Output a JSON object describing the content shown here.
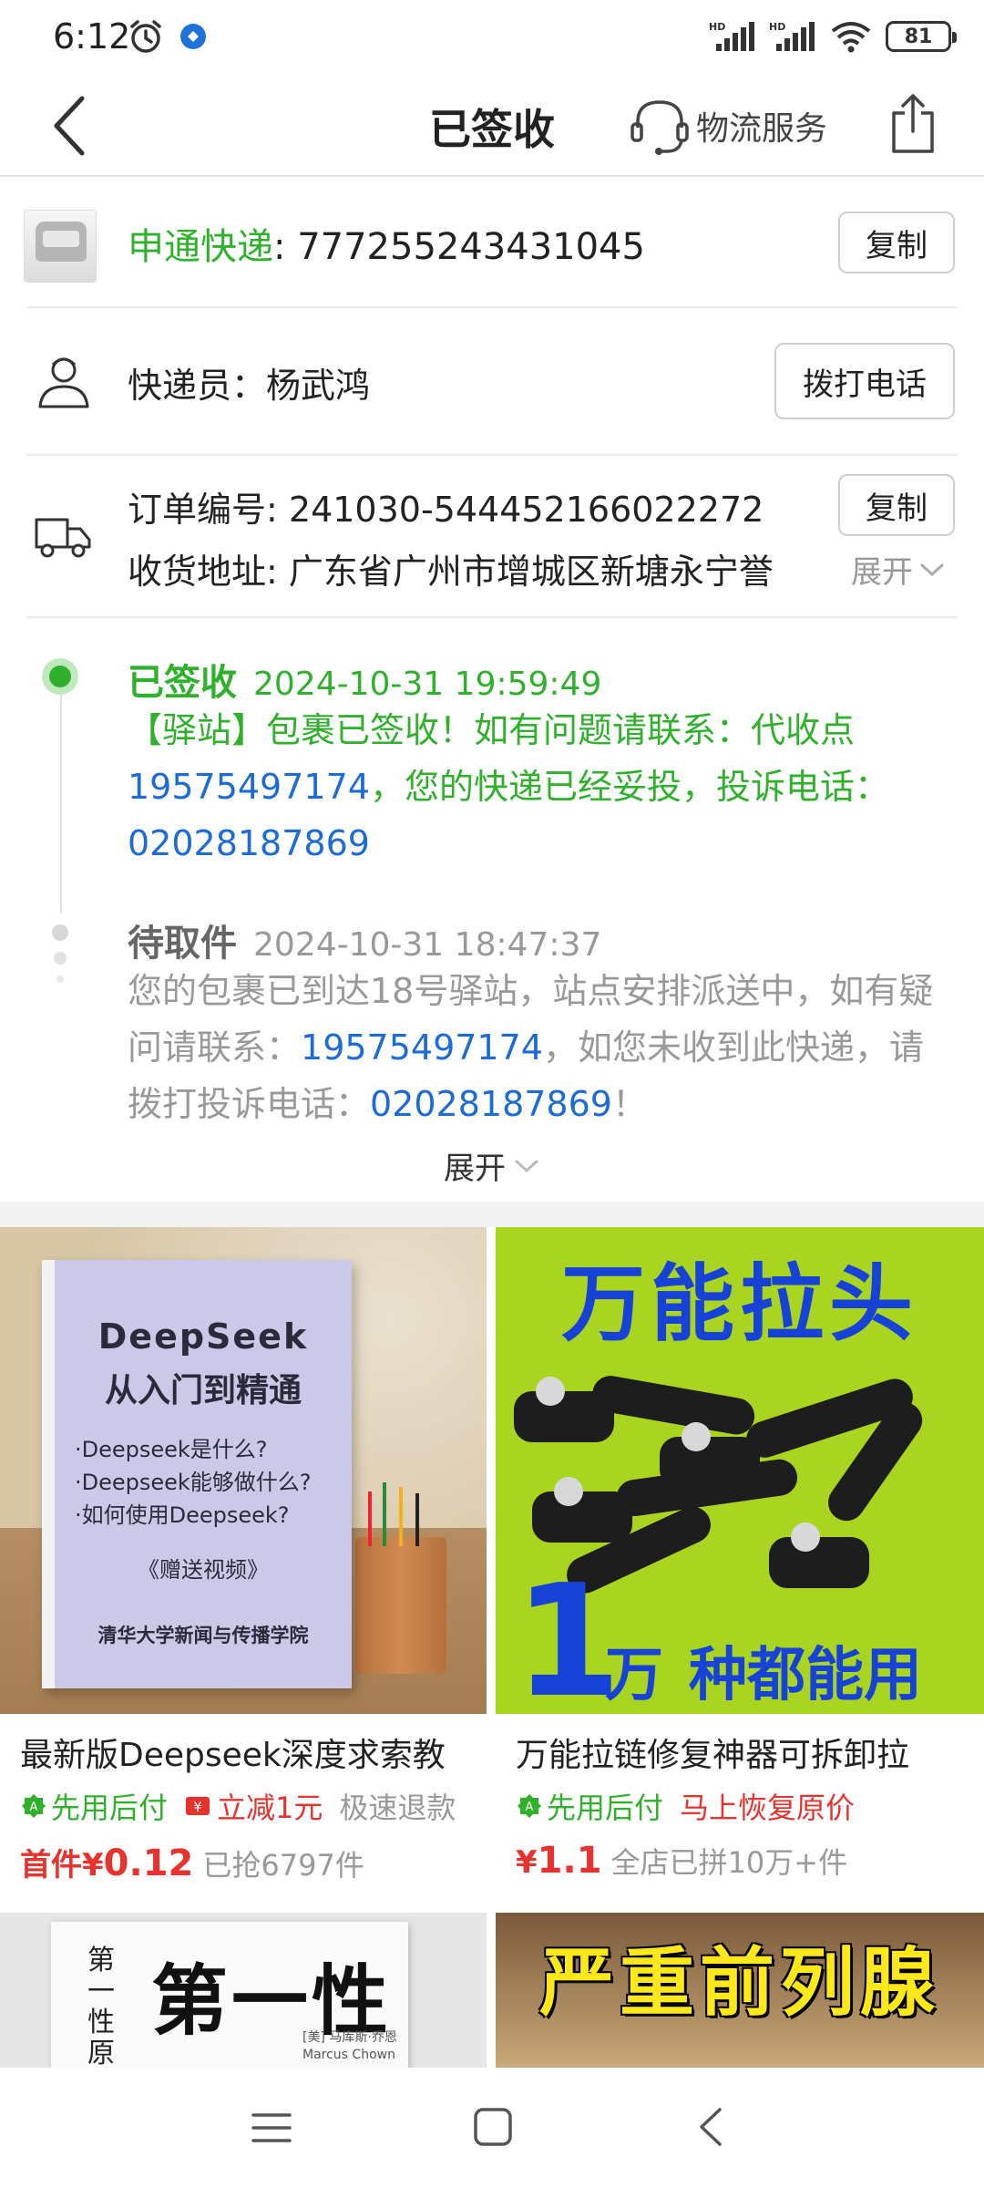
{
  "status_bar": {
    "time": "6:12",
    "battery": "81",
    "alarm_icon": "alarm-clock-icon",
    "app_icon": "app-notification-icon"
  },
  "header": {
    "title": "已签收",
    "logistics_service": "物流服务"
  },
  "express": {
    "carrier": "申通快递",
    "separator": ": ",
    "number": "777255243431045",
    "copy_label": "复制"
  },
  "courier": {
    "label": "快递员：",
    "name": "杨武鸿",
    "call_label": "拨打电话"
  },
  "order": {
    "order_label": "订单编号: ",
    "order_number": "241030-544452166022272",
    "copy_label": "复制",
    "address_label": "收货地址: ",
    "address": "广东省广州市增城区新塘永宁誉",
    "expand_label": "展开"
  },
  "timeline": [
    {
      "status": "已签收",
      "time": "2024-10-31 19:59:49",
      "text_a": "【驿站】包裹已签收！如有问题请联系：代收点",
      "phone_a": "19575497174",
      "text_b": "，您的快递已经妥投，投诉电话：",
      "phone_b": "02028187869"
    },
    {
      "status": "待取件",
      "time": "2024-10-31 18:47:37",
      "text_a": "您的包裹已到达18号驿站，站点安排派送中，如有疑问请联系：",
      "phone_a": "19575497174",
      "text_b": "，如您未收到此快递，请拨打投诉电话：",
      "phone_b": "02028187869",
      "text_c": "！"
    }
  ],
  "expand_more": "展开",
  "products": [
    {
      "title": "最新版Deepseek深度求索教",
      "tags": [
        "先用后付",
        "立减1元",
        "极速退款"
      ],
      "price_prefix": "首件¥",
      "price": "0.12",
      "sold": "已抢6797件",
      "image_text": {
        "brand": "DeepSeek",
        "subtitle": "从入门到精通",
        "q1": "·Deepseek是什么?",
        "q2": "·Deepseek能够做什么?",
        "q3": "·如何使用Deepseek?",
        "bonus": "《赠送视频》",
        "publisher": "清华大学新闻与传播学院"
      }
    },
    {
      "title": "万能拉链修复神器可拆卸拉",
      "tags": [
        "先用后付",
        "马上恢复原价"
      ],
      "price_prefix": "¥",
      "price": "1.1",
      "sold": "全店已拼10万+件",
      "image_text": {
        "headline": "万能拉头",
        "big_num": "1",
        "wan": "万",
        "footer": "种都能用"
      }
    },
    {
      "image_text": {
        "title_v": "第一性原理",
        "author": "[美] 马库斯·乔恩",
        "author_en": "Marcus Chown"
      }
    },
    {
      "image_text": {
        "headline": "严重前列腺"
      }
    }
  ],
  "colors": {
    "green": "#2fb12c",
    "blue": "#1d6bd6",
    "red": "#e8322e",
    "grey": "#999999"
  }
}
